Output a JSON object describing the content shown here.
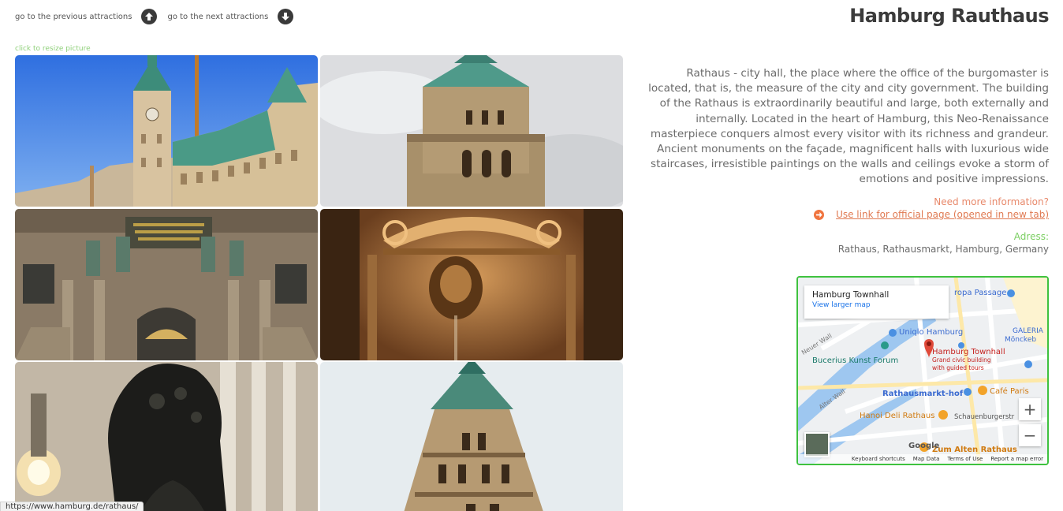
{
  "nav": {
    "prev_label": "go to the previous attractions",
    "next_label": "go to the next attractions"
  },
  "title": "Hamburg Rauthaus",
  "resize_hint": "click to resize picture",
  "description": "Rathaus - city hall, the place where the office of the burgomaster is located, that is, the measure of the city and city government. The building of the Rathaus is extraordinarily beautiful and large, both externally and internally. Located in the heart of Hamburg, this Neo-Renaissance masterpiece conquers almost every visitor with its richness and grandeur. Ancient monuments on the façade, magnificent halls with luxurious wide staircases, irresistible paintings on the walls and ceilings evoke a storm of emotions and positive impressions.",
  "more_info": "Need more information?",
  "official_link": "Use link for official page (opened in new tab)",
  "address": {
    "label": "Adress:",
    "value": "Rathaus, Rathausmarkt, Hamburg, Germany"
  },
  "map": {
    "place_title": "Hamburg Townhall",
    "view_larger": "View larger map",
    "pin_label": "Hamburg Townhall",
    "pin_desc1": "Grand civic building",
    "pin_desc2": "with guided tours",
    "labels": {
      "passage": "ropa Passage",
      "uniqlo": "Uniqlo Hamburg",
      "bucerius": "Bucerius Kunst Forum",
      "galeria1": "GALERIA",
      "galeria2": "Mönckeb",
      "rathausmarkt": "Rathausmarkt-hof",
      "cafe": "Café Paris",
      "hanoi": "Hanoi Deli Rathaus",
      "schauenburger": "Schauenburgerstr",
      "alten": "Zum Alten Rathaus",
      "neuer_wall": "Neuer Wall",
      "alter_wall": "Alter Wall",
      "google": "Google"
    },
    "zoom_in": "+",
    "zoom_out": "−",
    "footer": [
      "Keyboard shortcuts",
      "Map Data",
      "Terms of Use",
      "Report a map error"
    ]
  },
  "status_url": "https://www.hamburg.de/rathaus/",
  "colors": {
    "accent_orange": "#e07a52",
    "accent_green": "#7bcf62",
    "map_border": "#3fc23f"
  }
}
